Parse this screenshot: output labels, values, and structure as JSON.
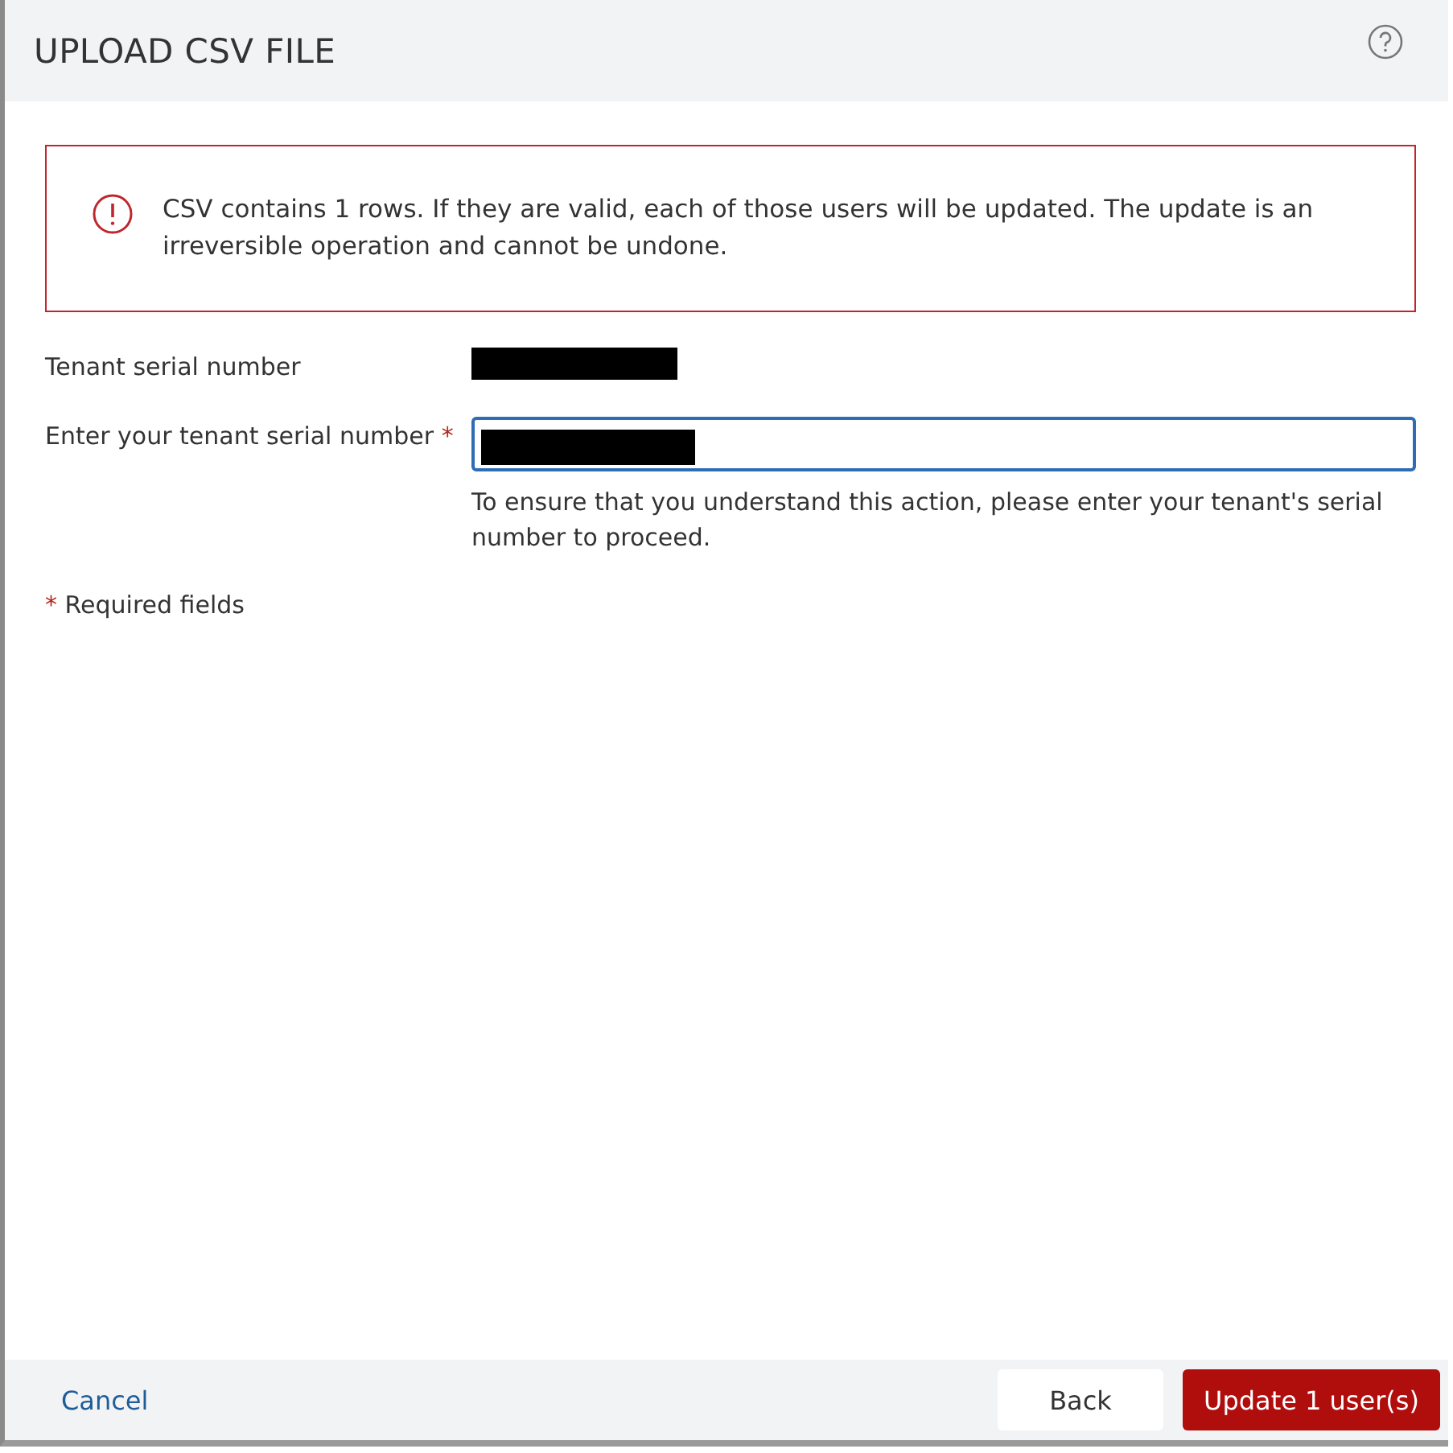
{
  "dialog": {
    "title": "UPLOAD CSV FILE",
    "help": true
  },
  "alert": {
    "kind": "error",
    "message": "CSV contains 1 rows. If they are valid, each of those users will be updated. The update is an irreversible operation and cannot be undone."
  },
  "fields": [
    {
      "kind": "readonly",
      "label": "Tenant serial number",
      "redacted": true
    },
    {
      "kind": "input",
      "label": "Enter your tenant serial number",
      "required_mark": "*",
      "redacted": true,
      "focused": true,
      "hint": "To ensure that you understand this action, please enter your tenant's serial number to proceed."
    }
  ],
  "required_note": {
    "mark": "*",
    "text": "Required fields"
  },
  "footer": {
    "cancel": "Cancel",
    "back": "Back",
    "submit": "Update 1 user(s)"
  }
}
